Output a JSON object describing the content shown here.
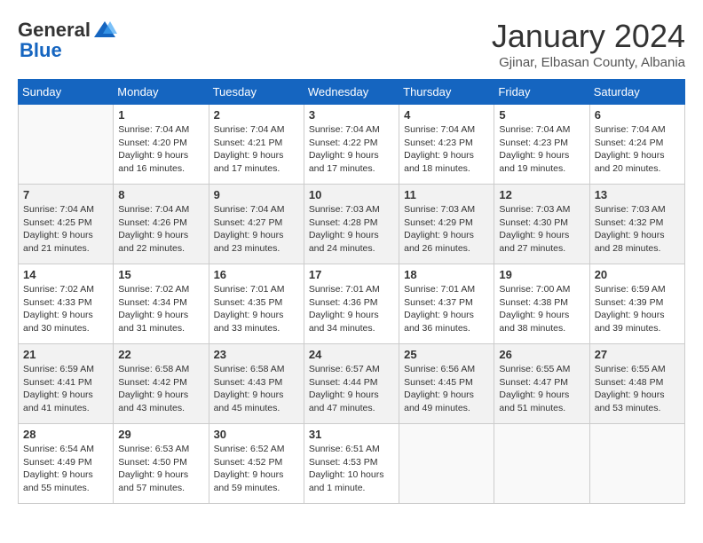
{
  "header": {
    "logo_general": "General",
    "logo_blue": "Blue",
    "month_title": "January 2024",
    "location": "Gjinar, Elbasan County, Albania"
  },
  "weekdays": [
    "Sunday",
    "Monday",
    "Tuesday",
    "Wednesday",
    "Thursday",
    "Friday",
    "Saturday"
  ],
  "weeks": [
    [
      {
        "day": "",
        "info": ""
      },
      {
        "day": "1",
        "info": "Sunrise: 7:04 AM\nSunset: 4:20 PM\nDaylight: 9 hours\nand 16 minutes."
      },
      {
        "day": "2",
        "info": "Sunrise: 7:04 AM\nSunset: 4:21 PM\nDaylight: 9 hours\nand 17 minutes."
      },
      {
        "day": "3",
        "info": "Sunrise: 7:04 AM\nSunset: 4:22 PM\nDaylight: 9 hours\nand 17 minutes."
      },
      {
        "day": "4",
        "info": "Sunrise: 7:04 AM\nSunset: 4:23 PM\nDaylight: 9 hours\nand 18 minutes."
      },
      {
        "day": "5",
        "info": "Sunrise: 7:04 AM\nSunset: 4:23 PM\nDaylight: 9 hours\nand 19 minutes."
      },
      {
        "day": "6",
        "info": "Sunrise: 7:04 AM\nSunset: 4:24 PM\nDaylight: 9 hours\nand 20 minutes."
      }
    ],
    [
      {
        "day": "7",
        "info": "Sunrise: 7:04 AM\nSunset: 4:25 PM\nDaylight: 9 hours\nand 21 minutes."
      },
      {
        "day": "8",
        "info": "Sunrise: 7:04 AM\nSunset: 4:26 PM\nDaylight: 9 hours\nand 22 minutes."
      },
      {
        "day": "9",
        "info": "Sunrise: 7:04 AM\nSunset: 4:27 PM\nDaylight: 9 hours\nand 23 minutes."
      },
      {
        "day": "10",
        "info": "Sunrise: 7:03 AM\nSunset: 4:28 PM\nDaylight: 9 hours\nand 24 minutes."
      },
      {
        "day": "11",
        "info": "Sunrise: 7:03 AM\nSunset: 4:29 PM\nDaylight: 9 hours\nand 26 minutes."
      },
      {
        "day": "12",
        "info": "Sunrise: 7:03 AM\nSunset: 4:30 PM\nDaylight: 9 hours\nand 27 minutes."
      },
      {
        "day": "13",
        "info": "Sunrise: 7:03 AM\nSunset: 4:32 PM\nDaylight: 9 hours\nand 28 minutes."
      }
    ],
    [
      {
        "day": "14",
        "info": "Sunrise: 7:02 AM\nSunset: 4:33 PM\nDaylight: 9 hours\nand 30 minutes."
      },
      {
        "day": "15",
        "info": "Sunrise: 7:02 AM\nSunset: 4:34 PM\nDaylight: 9 hours\nand 31 minutes."
      },
      {
        "day": "16",
        "info": "Sunrise: 7:01 AM\nSunset: 4:35 PM\nDaylight: 9 hours\nand 33 minutes."
      },
      {
        "day": "17",
        "info": "Sunrise: 7:01 AM\nSunset: 4:36 PM\nDaylight: 9 hours\nand 34 minutes."
      },
      {
        "day": "18",
        "info": "Sunrise: 7:01 AM\nSunset: 4:37 PM\nDaylight: 9 hours\nand 36 minutes."
      },
      {
        "day": "19",
        "info": "Sunrise: 7:00 AM\nSunset: 4:38 PM\nDaylight: 9 hours\nand 38 minutes."
      },
      {
        "day": "20",
        "info": "Sunrise: 6:59 AM\nSunset: 4:39 PM\nDaylight: 9 hours\nand 39 minutes."
      }
    ],
    [
      {
        "day": "21",
        "info": "Sunrise: 6:59 AM\nSunset: 4:41 PM\nDaylight: 9 hours\nand 41 minutes."
      },
      {
        "day": "22",
        "info": "Sunrise: 6:58 AM\nSunset: 4:42 PM\nDaylight: 9 hours\nand 43 minutes."
      },
      {
        "day": "23",
        "info": "Sunrise: 6:58 AM\nSunset: 4:43 PM\nDaylight: 9 hours\nand 45 minutes."
      },
      {
        "day": "24",
        "info": "Sunrise: 6:57 AM\nSunset: 4:44 PM\nDaylight: 9 hours\nand 47 minutes."
      },
      {
        "day": "25",
        "info": "Sunrise: 6:56 AM\nSunset: 4:45 PM\nDaylight: 9 hours\nand 49 minutes."
      },
      {
        "day": "26",
        "info": "Sunrise: 6:55 AM\nSunset: 4:47 PM\nDaylight: 9 hours\nand 51 minutes."
      },
      {
        "day": "27",
        "info": "Sunrise: 6:55 AM\nSunset: 4:48 PM\nDaylight: 9 hours\nand 53 minutes."
      }
    ],
    [
      {
        "day": "28",
        "info": "Sunrise: 6:54 AM\nSunset: 4:49 PM\nDaylight: 9 hours\nand 55 minutes."
      },
      {
        "day": "29",
        "info": "Sunrise: 6:53 AM\nSunset: 4:50 PM\nDaylight: 9 hours\nand 57 minutes."
      },
      {
        "day": "30",
        "info": "Sunrise: 6:52 AM\nSunset: 4:52 PM\nDaylight: 9 hours\nand 59 minutes."
      },
      {
        "day": "31",
        "info": "Sunrise: 6:51 AM\nSunset: 4:53 PM\nDaylight: 10 hours\nand 1 minute."
      },
      {
        "day": "",
        "info": ""
      },
      {
        "day": "",
        "info": ""
      },
      {
        "day": "",
        "info": ""
      }
    ]
  ]
}
